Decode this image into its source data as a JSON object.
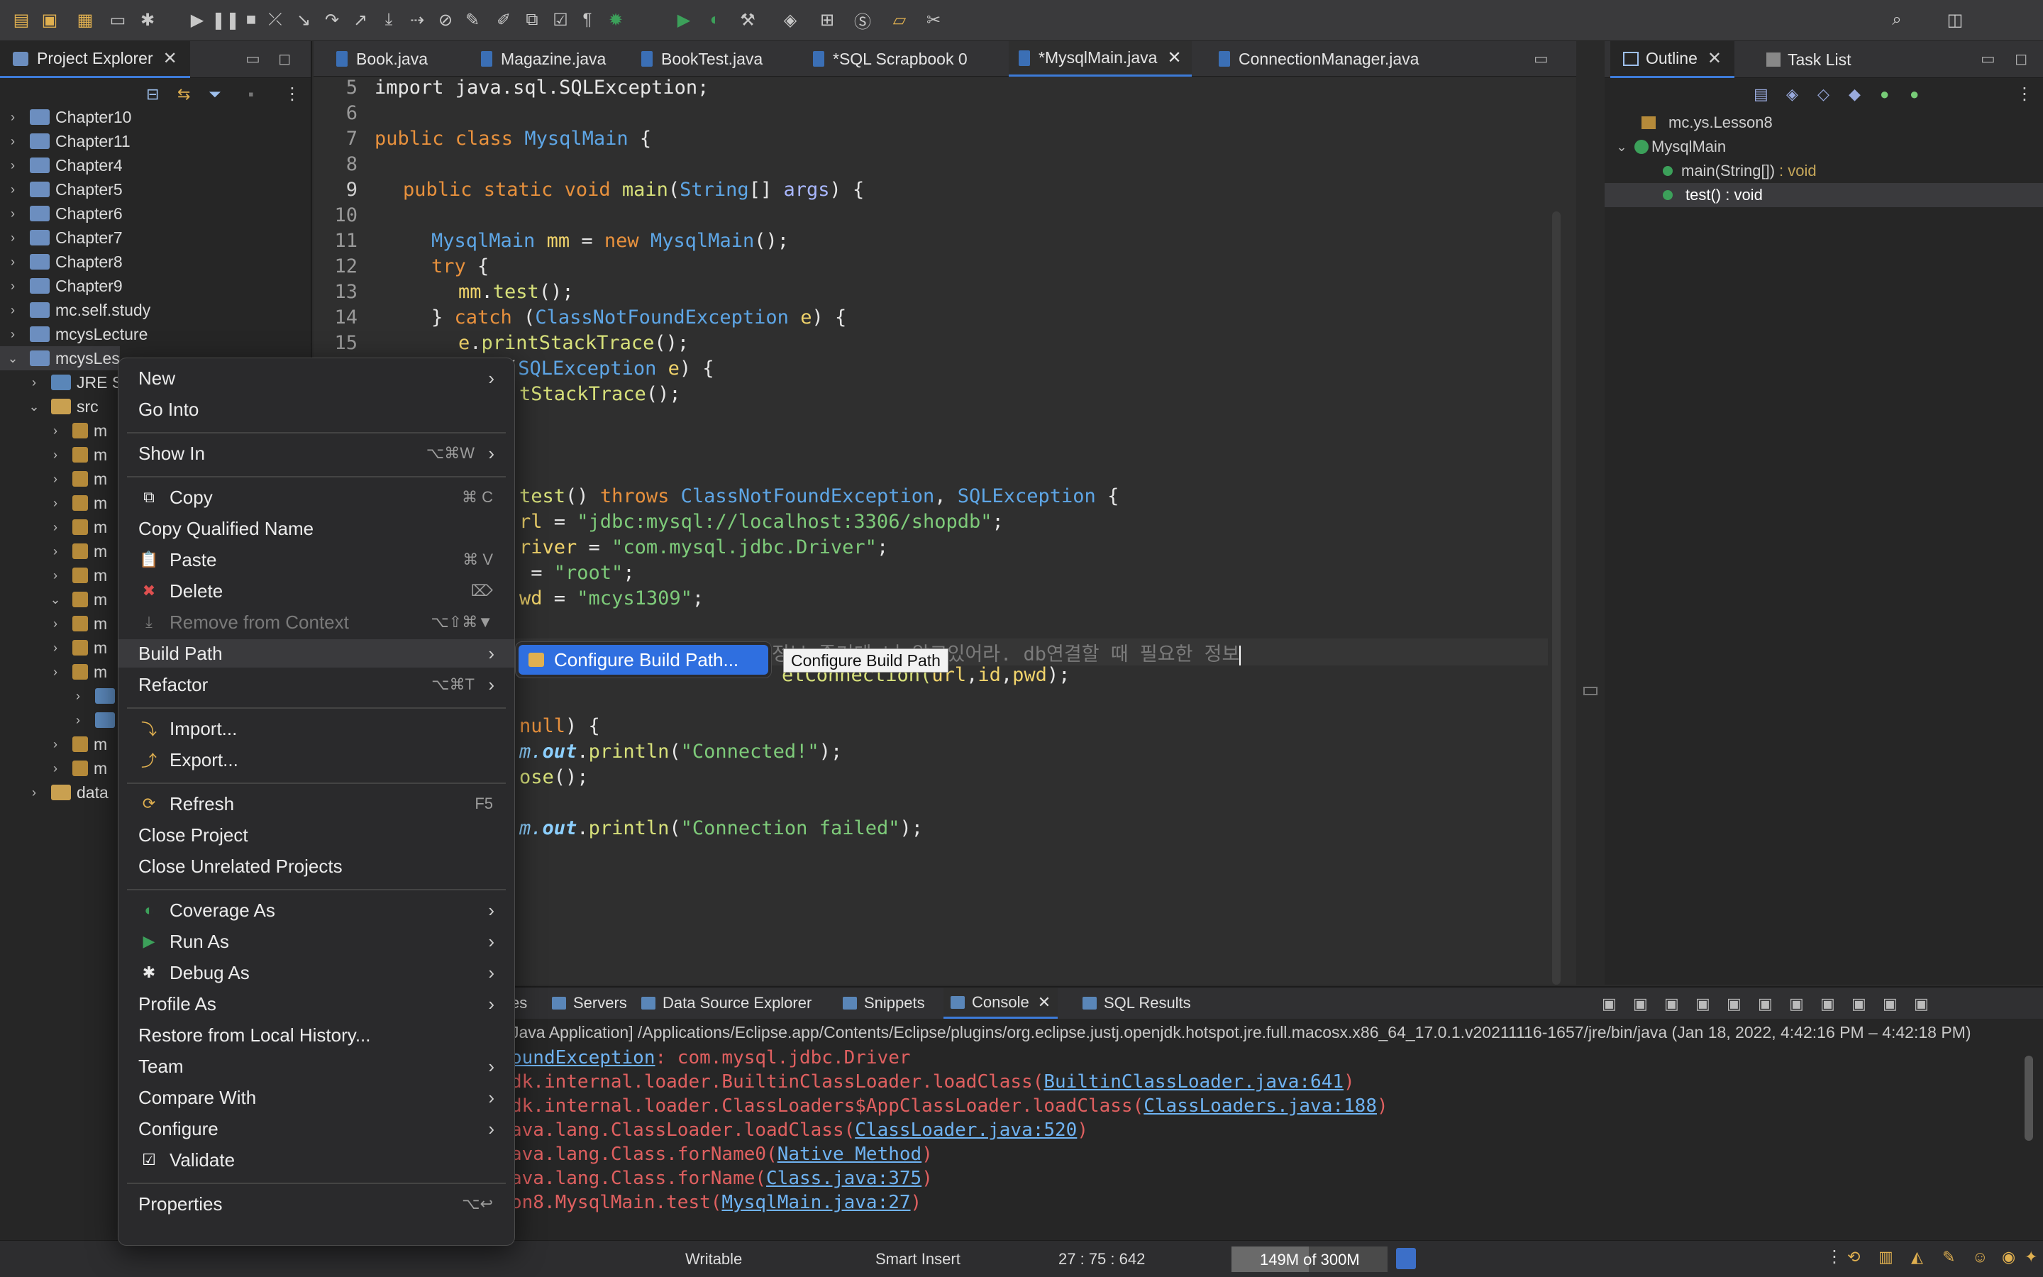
{
  "toolbar_icons": [
    "new-icon",
    "save-icon",
    "save-all-icon",
    "window-icon",
    "debug-icon",
    "resume-icon",
    "suspend-icon",
    "terminate-icon",
    "disconnect-icon",
    "step-into-icon",
    "step-over-icon",
    "step-return-icon",
    "drop-frame-icon",
    "use-step-filters-icon",
    "skip-breakpoints-icon",
    "toggle-mark-occurrences-icon",
    "highlight-icon",
    "open-type-icon",
    "open-task-icon",
    "show-whitespace-icon",
    "debug-run-icon",
    "run-icon",
    "coverage-icon",
    "external-tools-icon",
    "new-java-project-icon",
    "new-package-icon",
    "new-class-icon",
    "open-icon",
    "pin-icon",
    "search-icon",
    "perspective-icon"
  ],
  "project_explorer": {
    "title": "Project Explorer",
    "items": [
      {
        "label": "Chapter10",
        "kind": "project"
      },
      {
        "label": "Chapter11",
        "kind": "project"
      },
      {
        "label": "Chapter4",
        "kind": "project"
      },
      {
        "label": "Chapter5",
        "kind": "project"
      },
      {
        "label": "Chapter6",
        "kind": "project"
      },
      {
        "label": "Chapter7",
        "kind": "project"
      },
      {
        "label": "Chapter8",
        "kind": "project"
      },
      {
        "label": "Chapter9",
        "kind": "project"
      },
      {
        "label": "mc.self.study",
        "kind": "project"
      },
      {
        "label": "mcysLecture",
        "kind": "project"
      },
      {
        "label": "mcysLes",
        "kind": "project"
      },
      {
        "label": "JRE S",
        "kind": "library"
      },
      {
        "label": "src",
        "kind": "folder"
      },
      {
        "label": "m",
        "kind": "package"
      },
      {
        "label": "m",
        "kind": "package"
      },
      {
        "label": "m",
        "kind": "package"
      },
      {
        "label": "m",
        "kind": "package"
      },
      {
        "label": "m",
        "kind": "package"
      },
      {
        "label": "m",
        "kind": "package"
      },
      {
        "label": "m",
        "kind": "package"
      },
      {
        "label": "m",
        "kind": "package"
      },
      {
        "label": "m",
        "kind": "package"
      },
      {
        "label": "m",
        "kind": "package"
      },
      {
        "label": "m",
        "kind": "package"
      },
      {
        "label": "",
        "kind": "file"
      },
      {
        "label": "",
        "kind": "file"
      },
      {
        "label": "m",
        "kind": "package"
      },
      {
        "label": "m",
        "kind": "package"
      },
      {
        "label": "data",
        "kind": "folder"
      }
    ]
  },
  "editor": {
    "tabs": [
      "Book.java",
      "Magazine.java",
      "BookTest.java",
      "*SQL Scrapbook 0",
      "*MysqlMain.java",
      "ConnectionManager.java"
    ],
    "line_numbers": [
      "5",
      "6",
      "7",
      "8",
      "9",
      "10",
      "11",
      "12",
      "13",
      "14",
      "15"
    ],
    "code": {
      "l5": "import java.sql.SQLException;",
      "l7a": "public class ",
      "l7b": "MysqlMain",
      "l7c": " {",
      "l9a": "public static void ",
      "l9b": "main",
      "l9c": "(",
      "l9d": "String",
      "l9e": "[] ",
      "l9f": "args",
      "l9g": ") {",
      "l11a": "MysqlMain",
      "l11b": " mm",
      "l11c": " = ",
      "l11d": "new ",
      "l11e": "MysqlMain",
      "l11f": "();",
      "l12a": "try",
      "l12b": " {",
      "l13a": "mm",
      "l13b": ".",
      "l13c": "test",
      "l13d": "();",
      "l14a": "} ",
      "l14b": "catch",
      "l14c": " (",
      "l14d": "ClassNotFoundException",
      "l14e": " e",
      "l14f": ") {",
      "l15a": "e",
      "l15b": ".",
      "l15c": "printStackTrace",
      "l15d": "();",
      "l16a": "(",
      "l16b": "SQLException",
      "l16c": " e",
      "l16d": ") {",
      "l17a": "tStackTrace",
      "l17b": "();",
      "l21a": "test",
      "l21b": "() ",
      "l21c": "throws ",
      "l21d": "ClassNotFoundException",
      "l21e": ", ",
      "l21f": "SQLException",
      "l21g": " {",
      "l22a": "rl",
      "l22b": " = ",
      "l22c": "\"jdbc:mysql://localhost:3306/shopdb\"",
      "l22d": ";",
      "l23a": "river",
      "l23b": " = ",
      "l23c": "\"com.mysql.jdbc.Driver\"",
      "l23d": ";",
      "l24a": " = ",
      "l24b": "\"root\"",
      "l24c": ";",
      "l25a": "wd",
      "l25b": " = ",
      "l25c": "\"mcys1309\"",
      "l25d": ";",
      "l27": "정보 줄거데 너 알고있어라. db연결할 때 필요한 정보",
      "l28a": "etConnection(",
      "l28b": "url",
      "l28c": ",",
      "l28d": "id",
      "l28e": ",",
      "l28f": "pwd",
      "l28g": ");",
      "l30a": "null",
      "l30b": ") {",
      "l31a": "m.",
      "l31b": "out",
      "l31c": ".",
      "l31d": "println",
      "l31e": "(",
      "l31f": "\"Connected!\"",
      "l31g": ");",
      "l32a": "ose",
      "l32b": "();",
      "l34a": "m.",
      "l34b": "out",
      "l34c": ".",
      "l34d": "println",
      "l34e": "(",
      "l34f": "\"Connection failed\"",
      "l34g": ");"
    }
  },
  "outline": {
    "tabs": [
      "Outline",
      "Task List"
    ],
    "items": [
      "mc.ys.Lesson8",
      "MysqlMain",
      "main(String[])",
      ": void",
      "test() : void"
    ]
  },
  "console": {
    "tabs": [
      "es",
      "Servers",
      "Data Source Explorer",
      "Snippets",
      "Console",
      "SQL Results"
    ],
    "header": "Java Application] /Applications/Eclipse.app/Contents/Eclipse/plugins/org.eclipse.justj.openjdk.hotspot.jre.full.macosx.x86_64_17.0.1.v20211116-1657/jre/bin/java  (Jan 18, 2022, 4:42:16 PM – 4:42:18 PM)",
    "lines": [
      {
        "pre": "oundException",
        ": ": "",
        "text": ": com.mysql.jdbc.Driver",
        "link": ""
      },
      {
        "pre": "dk.internal.loader.BuiltinClassLoader.loadClass(",
        "link": "BuiltinClassLoader.java:641",
        "post": ")"
      },
      {
        "pre": "dk.internal.loader.ClassLoaders$AppClassLoader.loadClass(",
        "link": "ClassLoaders.java:188",
        "post": ")"
      },
      {
        "pre": "ava.lang.ClassLoader.loadClass(",
        "link": "ClassLoader.java:520",
        "post": ")"
      },
      {
        "pre": "ava.lang.Class.forName0(",
        "link": "Native Method",
        "post": ")"
      },
      {
        "pre": "ava.lang.Class.forName(",
        "link": "Class.java:375",
        "post": ")"
      },
      {
        "pre": "on8.MysqlMain.test(",
        "link": "MysqlMain.java:27",
        "post": ")"
      }
    ]
  },
  "status": {
    "writable": "Writable",
    "insert_mode": "Smart Insert",
    "position": "27 : 75 : 642",
    "heap": "149M of 300M",
    "heap_fraction": 0.497
  },
  "context_menu": {
    "items": [
      {
        "label": "New",
        "icon": "",
        "shortcut": "",
        "submenu": true,
        "disabled": false
      },
      {
        "label": "Go Into",
        "icon": "",
        "shortcut": "",
        "submenu": false,
        "disabled": false
      },
      {
        "sep": true
      },
      {
        "label": "Show In",
        "icon": "",
        "shortcut": "⌥⌘W",
        "submenu": true,
        "disabled": false
      },
      {
        "sep": true
      },
      {
        "label": "Copy",
        "icon": "copy-icon",
        "shortcut": "⌘ C",
        "submenu": false,
        "disabled": false
      },
      {
        "label": "Copy Qualified Name",
        "icon": "",
        "shortcut": "",
        "submenu": false,
        "disabled": false
      },
      {
        "label": "Paste",
        "icon": "paste-icon",
        "shortcut": "⌘ V",
        "submenu": false,
        "disabled": false
      },
      {
        "label": "Delete",
        "icon": "delete-icon",
        "shortcut": "⌦",
        "submenu": false,
        "disabled": false
      },
      {
        "label": "Remove from Context",
        "icon": "remove-context-icon",
        "shortcut": "⌥⇧⌘▼",
        "submenu": false,
        "disabled": true
      },
      {
        "label": "Build Path",
        "icon": "",
        "shortcut": "",
        "submenu": true,
        "disabled": false,
        "highlight": true
      },
      {
        "label": "Refactor",
        "icon": "",
        "shortcut": "⌥⌘T",
        "submenu": true,
        "disabled": false
      },
      {
        "sep": true
      },
      {
        "label": "Import...",
        "icon": "import-icon",
        "shortcut": "",
        "submenu": false,
        "disabled": false
      },
      {
        "label": "Export...",
        "icon": "export-icon",
        "shortcut": "",
        "submenu": false,
        "disabled": false
      },
      {
        "sep": true
      },
      {
        "label": "Refresh",
        "icon": "refresh-icon",
        "shortcut": "F5",
        "submenu": false,
        "disabled": false
      },
      {
        "label": "Close Project",
        "icon": "",
        "shortcut": "",
        "submenu": false,
        "disabled": false
      },
      {
        "label": "Close Unrelated Projects",
        "icon": "",
        "shortcut": "",
        "submenu": false,
        "disabled": false
      },
      {
        "sep": true
      },
      {
        "label": "Coverage As",
        "icon": "coverage-icon",
        "shortcut": "",
        "submenu": true,
        "disabled": false
      },
      {
        "label": "Run As",
        "icon": "run-icon",
        "shortcut": "",
        "submenu": true,
        "disabled": false
      },
      {
        "label": "Debug As",
        "icon": "debug-icon",
        "shortcut": "",
        "submenu": true,
        "disabled": false
      },
      {
        "label": "Profile As",
        "icon": "",
        "shortcut": "",
        "submenu": true,
        "disabled": false
      },
      {
        "label": "Restore from Local History...",
        "icon": "",
        "shortcut": "",
        "submenu": false,
        "disabled": false
      },
      {
        "label": "Team",
        "icon": "",
        "shortcut": "",
        "submenu": true,
        "disabled": false
      },
      {
        "label": "Compare With",
        "icon": "",
        "shortcut": "",
        "submenu": true,
        "disabled": false
      },
      {
        "label": "Configure",
        "icon": "",
        "shortcut": "",
        "submenu": true,
        "disabled": false
      },
      {
        "label": "Validate",
        "icon": "checkbox-checked-icon",
        "shortcut": "",
        "submenu": false,
        "disabled": false
      },
      {
        "sep": true
      },
      {
        "label": "Properties",
        "icon": "",
        "shortcut": "⌥↩",
        "submenu": false,
        "disabled": false
      }
    ],
    "submenu_item": "Configure Build Path...",
    "tooltip": "Configure Build Path"
  },
  "colors": {
    "accent": "#2f6fe0",
    "keyword": "#e8913d",
    "type": "#5ea6e6",
    "string": "#7ecb7a",
    "error": "#e06060"
  }
}
